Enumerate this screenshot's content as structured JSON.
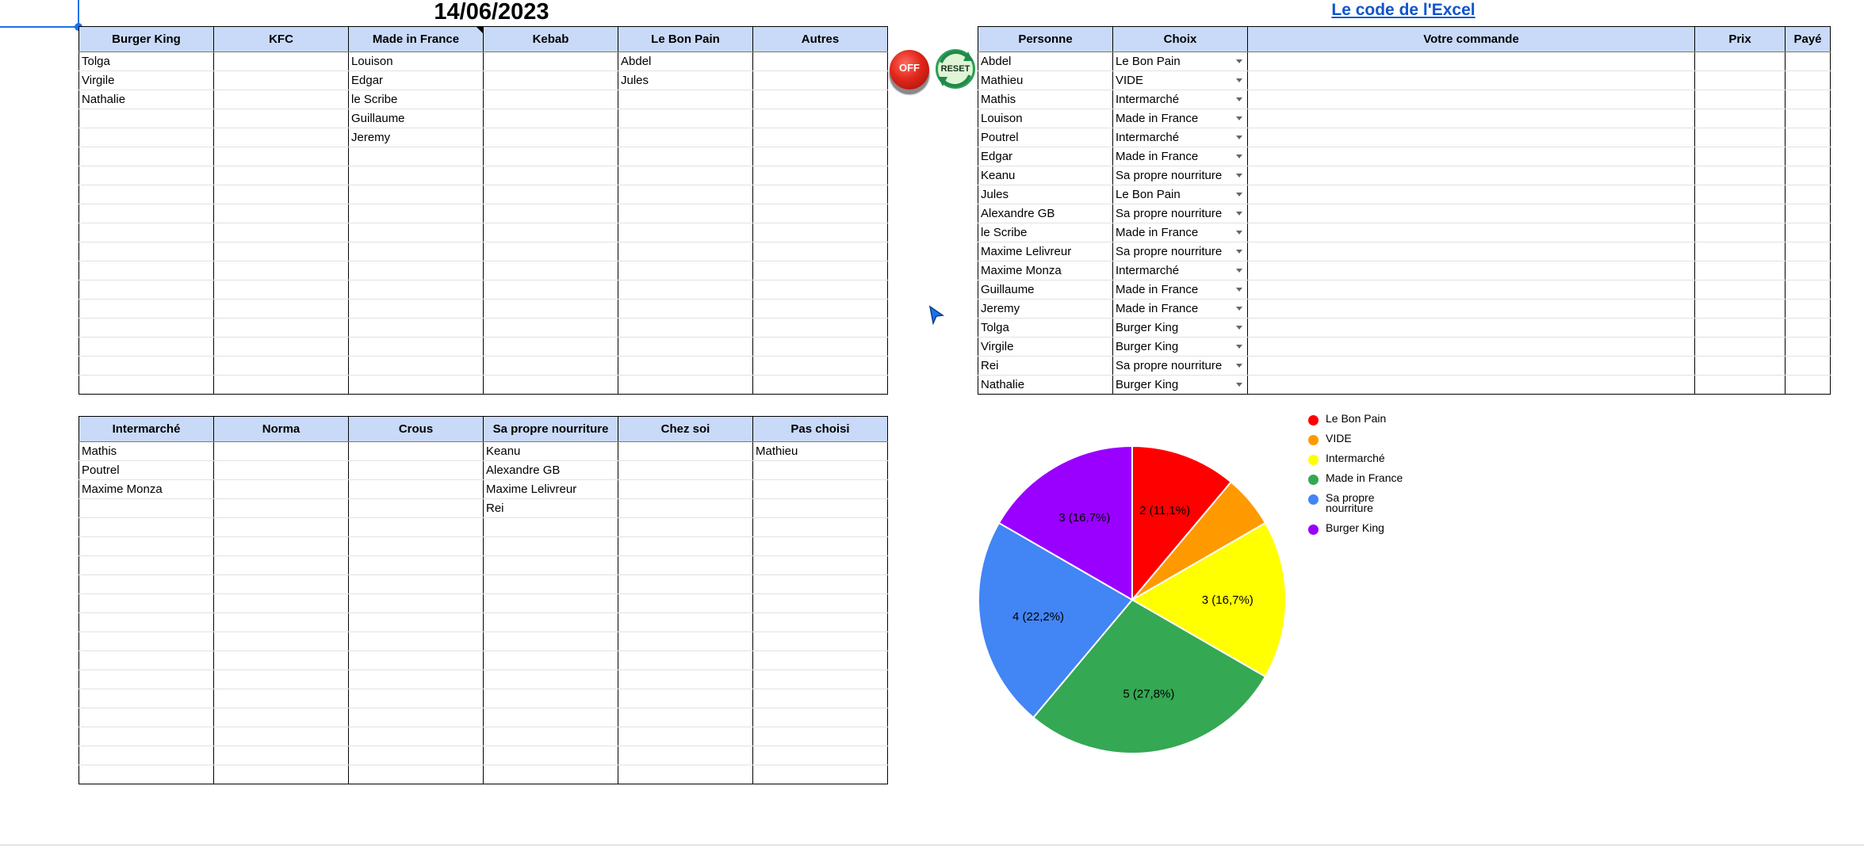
{
  "header": {
    "date": "14/06/2023",
    "link_text": "Le code de l'Excel"
  },
  "table1": {
    "columns": [
      "Burger King",
      "KFC",
      "Made in France",
      "Kebab",
      "Le Bon Pain",
      "Autres"
    ],
    "rows": [
      [
        "Tolga",
        "",
        "Louison",
        "",
        "Abdel",
        ""
      ],
      [
        "Virgile",
        "",
        "Edgar",
        "",
        "Jules",
        ""
      ],
      [
        "Nathalie",
        "",
        "le Scribe",
        "",
        "",
        ""
      ],
      [
        "",
        "",
        "Guillaume",
        "",
        "",
        ""
      ],
      [
        "",
        "",
        "Jeremy",
        "",
        "",
        ""
      ],
      [
        "",
        "",
        "",
        "",
        "",
        ""
      ],
      [
        "",
        "",
        "",
        "",
        "",
        ""
      ],
      [
        "",
        "",
        "",
        "",
        "",
        ""
      ],
      [
        "",
        "",
        "",
        "",
        "",
        ""
      ],
      [
        "",
        "",
        "",
        "",
        "",
        ""
      ],
      [
        "",
        "",
        "",
        "",
        "",
        ""
      ],
      [
        "",
        "",
        "",
        "",
        "",
        ""
      ],
      [
        "",
        "",
        "",
        "",
        "",
        ""
      ],
      [
        "",
        "",
        "",
        "",
        "",
        ""
      ],
      [
        "",
        "",
        "",
        "",
        "",
        ""
      ],
      [
        "",
        "",
        "",
        "",
        "",
        ""
      ],
      [
        "",
        "",
        "",
        "",
        "",
        ""
      ],
      [
        "",
        "",
        "",
        "",
        "",
        ""
      ]
    ]
  },
  "table2": {
    "columns": [
      "Intermarché",
      "Norma",
      "Crous",
      "Sa propre nourriture",
      "Chez soi",
      "Pas choisi"
    ],
    "rows": [
      [
        "Mathis",
        "",
        "",
        "Keanu",
        "",
        "Mathieu"
      ],
      [
        "Poutrel",
        "",
        "",
        "Alexandre GB",
        "",
        ""
      ],
      [
        "Maxime Monza",
        "",
        "",
        "Maxime Lelivreur",
        "",
        ""
      ],
      [
        "",
        "",
        "",
        "Rei",
        "",
        ""
      ],
      [
        "",
        "",
        "",
        "",
        "",
        ""
      ],
      [
        "",
        "",
        "",
        "",
        "",
        ""
      ],
      [
        "",
        "",
        "",
        "",
        "",
        ""
      ],
      [
        "",
        "",
        "",
        "",
        "",
        ""
      ],
      [
        "",
        "",
        "",
        "",
        "",
        ""
      ],
      [
        "",
        "",
        "",
        "",
        "",
        ""
      ],
      [
        "",
        "",
        "",
        "",
        "",
        ""
      ],
      [
        "",
        "",
        "",
        "",
        "",
        ""
      ],
      [
        "",
        "",
        "",
        "",
        "",
        ""
      ],
      [
        "",
        "",
        "",
        "",
        "",
        ""
      ],
      [
        "",
        "",
        "",
        "",
        "",
        ""
      ],
      [
        "",
        "",
        "",
        "",
        "",
        ""
      ],
      [
        "",
        "",
        "",
        "",
        "",
        ""
      ],
      [
        "",
        "",
        "",
        "",
        "",
        ""
      ]
    ]
  },
  "orders": {
    "columns": [
      "Personne",
      "Choix",
      "Votre commande",
      "Prix",
      "Payé"
    ],
    "rows": [
      [
        "Abdel",
        "Le Bon Pain",
        "",
        "",
        ""
      ],
      [
        "Mathieu",
        "VIDE",
        "",
        "",
        ""
      ],
      [
        "Mathis",
        "Intermarché",
        "",
        "",
        ""
      ],
      [
        "Louison",
        "Made in France",
        "",
        "",
        ""
      ],
      [
        "Poutrel",
        "Intermarché",
        "",
        "",
        ""
      ],
      [
        "Edgar",
        "Made in France",
        "",
        "",
        ""
      ],
      [
        "Keanu",
        "Sa propre nourriture",
        "",
        "",
        ""
      ],
      [
        "Jules",
        "Le Bon Pain",
        "",
        "",
        ""
      ],
      [
        "Alexandre GB",
        "Sa propre nourriture",
        "",
        "",
        ""
      ],
      [
        "le Scribe",
        "Made in France",
        "",
        "",
        ""
      ],
      [
        "Maxime Lelivreur",
        "Sa propre nourriture",
        "",
        "",
        ""
      ],
      [
        "Maxime Monza",
        "Intermarché",
        "",
        "",
        ""
      ],
      [
        "Guillaume",
        "Made in France",
        "",
        "",
        ""
      ],
      [
        "Jeremy",
        "Made in France",
        "",
        "",
        ""
      ],
      [
        "Tolga",
        "Burger King",
        "",
        "",
        ""
      ],
      [
        "Virgile",
        "Burger King",
        "",
        "",
        ""
      ],
      [
        "Rei",
        "Sa propre nourriture",
        "",
        "",
        ""
      ],
      [
        "Nathalie",
        "Burger King",
        "",
        "",
        ""
      ]
    ]
  },
  "buttons": {
    "off_label": "OFF",
    "reset_label": "RESET"
  },
  "icons": {
    "off": "power-off-button-icon",
    "reset": "reset-refresh-icon",
    "cursor": "mouse-pointer-icon"
  },
  "chart_data": {
    "type": "pie",
    "labels": [
      "Le Bon Pain",
      "VIDE",
      "Intermarché",
      "Made in France",
      "Sa propre nourriture",
      "Burger King"
    ],
    "values": [
      2,
      1,
      3,
      5,
      4,
      3
    ],
    "data_labels": [
      "2 (11,1%)",
      "",
      "3 (16,7%)",
      "5 (27,8%)",
      "4 (22,2%)",
      "3 (16,7%)"
    ],
    "colors": [
      "#ff0000",
      "#ff9900",
      "#ffff00",
      "#34a853",
      "#4285f4",
      "#9900ff"
    ],
    "legend_position": "right"
  }
}
